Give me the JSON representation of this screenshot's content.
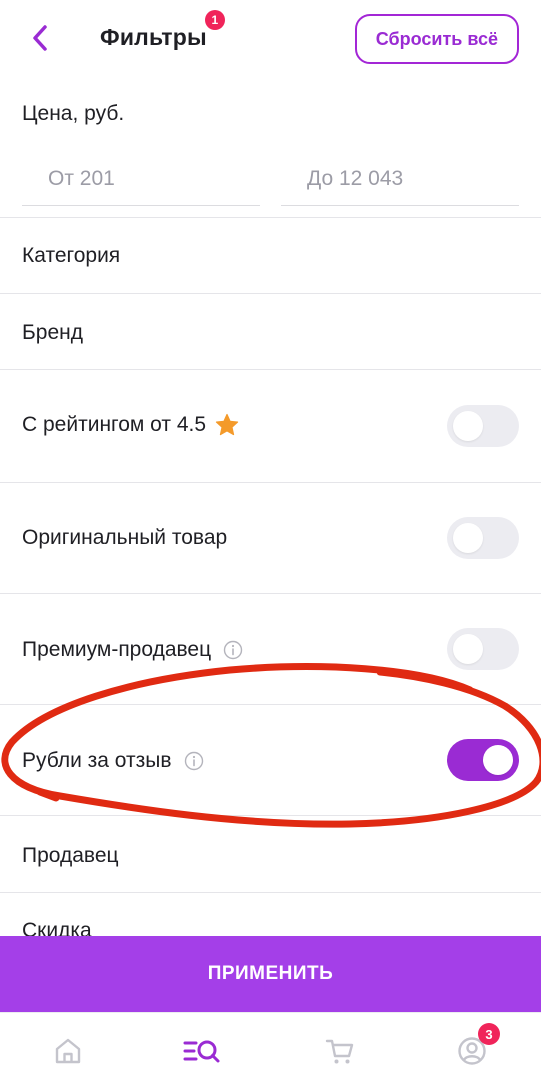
{
  "header": {
    "title": "Фильтры",
    "title_badge": "1",
    "reset_label": "Сбросить всё"
  },
  "price": {
    "label": "Цена, руб.",
    "from_placeholder": "От 201",
    "to_placeholder": "До 12 043"
  },
  "filters": {
    "category": "Категория",
    "brand": "Бренд",
    "rating": {
      "label": "С рейтингом от 4.5",
      "enabled": false
    },
    "original": {
      "label": "Оригинальный товар",
      "enabled": false
    },
    "premium_seller": {
      "label": "Премиум-продавец",
      "enabled": false
    },
    "rubles_for_review": {
      "label": "Рубли за отзыв",
      "enabled": true
    },
    "seller": "Продавец",
    "discount": "Скидка"
  },
  "apply_label": "ПРИМЕНИТЬ",
  "tabbar": {
    "items": [
      "home-icon",
      "catalog-icon",
      "cart-icon",
      "profile-icon"
    ],
    "profile_badge": "3"
  },
  "colors": {
    "accent": "#9a2bd3",
    "apply_button": "#a43fe8",
    "badge": "#f0245a",
    "annotation": "#e02a12",
    "star": "#f49a2a"
  }
}
